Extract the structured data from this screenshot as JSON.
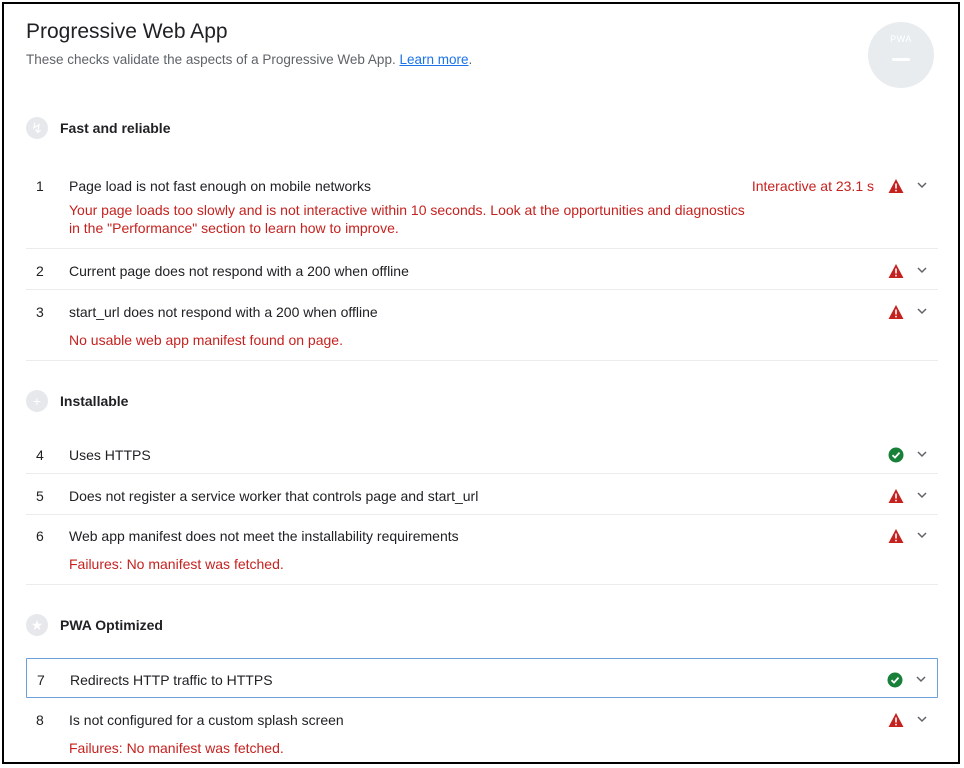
{
  "header": {
    "title": "Progressive Web App",
    "description": "These checks validate the aspects of a Progressive Web App.",
    "learn_more": "Learn more",
    "period": ".",
    "badge_label": "PWA"
  },
  "groups": [
    {
      "title": "Fast and reliable",
      "icon": "lightning-icon"
    },
    {
      "title": "Installable",
      "icon": "plus-icon"
    },
    {
      "title": "PWA Optimized",
      "icon": "star-icon"
    }
  ],
  "audits": [
    {
      "number": "1",
      "title": "Page load is not fast enough on mobile networks",
      "value": "Interactive at 23.1 s",
      "status": "fail",
      "description": "Your page loads too slowly and is not interactive within 10 seconds. Look at the opportunities and diagnostics in the \"Performance\" section to learn how to improve."
    },
    {
      "number": "2",
      "title": "Current page does not respond with a 200 when offline",
      "status": "fail"
    },
    {
      "number": "3",
      "title": "start_url does not respond with a 200 when offline",
      "status": "fail",
      "description": "No usable web app manifest found on page."
    },
    {
      "number": "4",
      "title": "Uses HTTPS",
      "status": "pass"
    },
    {
      "number": "5",
      "title": "Does not register a service worker that controls page and start_url",
      "status": "fail"
    },
    {
      "number": "6",
      "title": "Web app manifest does not meet the installability requirements",
      "status": "fail",
      "description": "Failures: No manifest was fetched."
    },
    {
      "number": "7",
      "title": "Redirects HTTP traffic to HTTPS",
      "status": "pass"
    },
    {
      "number": "8",
      "title": "Is not configured for a custom splash screen",
      "status": "fail",
      "description": "Failures: No manifest was fetched."
    }
  ],
  "colors": {
    "fail": "#c5221f",
    "pass": "#188038",
    "link": "#1a73e8"
  }
}
